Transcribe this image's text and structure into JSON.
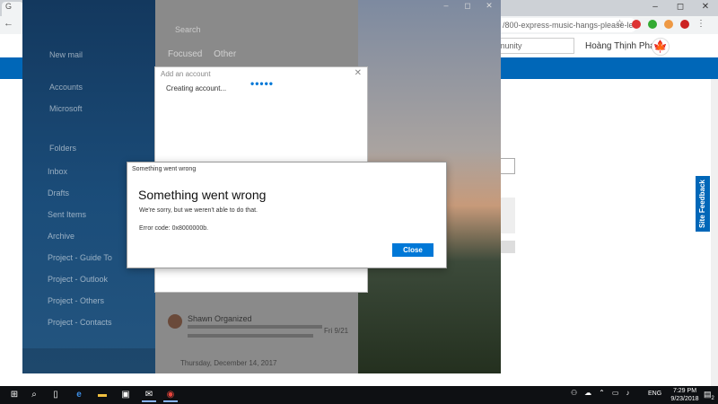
{
  "browser": {
    "tab_label": "G",
    "url_text": "/800-express-music-hangs-please-le...",
    "window_controls": [
      "–",
      "◻",
      "✕"
    ]
  },
  "site": {
    "search_placeholder": "munity",
    "user_name": "Hoàng Thịnh Phạm",
    "feedback_label": "Site Feedback"
  },
  "mail_app": {
    "search_label": "Search",
    "tabs": [
      "Focused",
      "Other"
    ],
    "sidebar_items": [
      "New mail",
      "Accounts",
      "Microsoft",
      "Folders",
      "Inbox",
      "Drafts",
      "Sent Items",
      "Archive",
      "Project - Guide To",
      "Project - Outlook",
      "Project - Others",
      "Project - Contacts"
    ],
    "mail_sender": "Shawn Organized",
    "mail_date": "Fri 9/21",
    "group_header": "Thursday, December 14, 2017"
  },
  "add_account_dialog": {
    "title": "Add an account",
    "status": "Creating account...",
    "dots": "•••••"
  },
  "error_dialog": {
    "title": "Something went wrong",
    "heading": "Something went wrong",
    "message": "We're sorry, but we weren't able to do that.",
    "code": "Error code: 0x8000000b.",
    "close_label": "Close"
  },
  "taskbar": {
    "language": "ENG",
    "time": "7:29 PM",
    "date": "9/23/2018",
    "notifications": "2"
  },
  "colors": {
    "accent": "#0078d7",
    "site_nav": "#0067b8",
    "taskbar": "#0e1013"
  }
}
